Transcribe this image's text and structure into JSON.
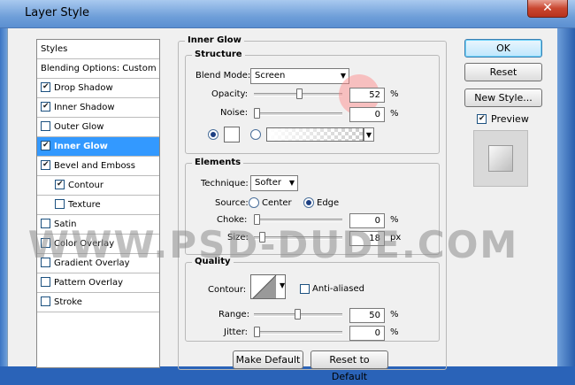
{
  "window": {
    "title": "Layer Style",
    "close_glyph": "✕"
  },
  "styles_panel": {
    "items": [
      {
        "label": "Styles",
        "checked": null,
        "indent": false,
        "selected": false
      },
      {
        "label": "Blending Options: Custom",
        "checked": null,
        "indent": false,
        "selected": false
      },
      {
        "label": "Drop Shadow",
        "checked": true,
        "indent": false,
        "selected": false
      },
      {
        "label": "Inner Shadow",
        "checked": true,
        "indent": false,
        "selected": false
      },
      {
        "label": "Outer Glow",
        "checked": false,
        "indent": false,
        "selected": false
      },
      {
        "label": "Inner Glow",
        "checked": true,
        "indent": false,
        "selected": true
      },
      {
        "label": "Bevel and Emboss",
        "checked": true,
        "indent": false,
        "selected": false
      },
      {
        "label": "Contour",
        "checked": true,
        "indent": true,
        "selected": false
      },
      {
        "label": "Texture",
        "checked": false,
        "indent": true,
        "selected": false
      },
      {
        "label": "Satin",
        "checked": false,
        "indent": false,
        "selected": false
      },
      {
        "label": "Color Overlay",
        "checked": false,
        "indent": false,
        "selected": false
      },
      {
        "label": "Gradient Overlay",
        "checked": false,
        "indent": false,
        "selected": false
      },
      {
        "label": "Pattern Overlay",
        "checked": false,
        "indent": false,
        "selected": false
      },
      {
        "label": "Stroke",
        "checked": false,
        "indent": false,
        "selected": false
      }
    ]
  },
  "inner_glow": {
    "section_title": "Inner Glow",
    "structure": {
      "title": "Structure",
      "blend_mode_label": "Blend Mode:",
      "blend_mode_value": "Screen",
      "opacity_label": "Opacity:",
      "opacity_value": "52",
      "opacity_fraction": 0.52,
      "noise_label": "Noise:",
      "noise_value": "0",
      "noise_fraction": 0.0,
      "unit": "%"
    },
    "elements": {
      "title": "Elements",
      "technique_label": "Technique:",
      "technique_value": "Softer",
      "source_label": "Source:",
      "source_center": "Center",
      "source_edge": "Edge",
      "choke_label": "Choke:",
      "choke_value": "0",
      "choke_fraction": 0.0,
      "choke_unit": "%",
      "size_label": "Size:",
      "size_value": "18",
      "size_fraction": 0.07,
      "size_unit": "px"
    },
    "quality": {
      "title": "Quality",
      "contour_label": "Contour:",
      "anti_aliased_label": "Anti-aliased",
      "range_label": "Range:",
      "range_value": "50",
      "range_fraction": 0.5,
      "range_unit": "%",
      "jitter_label": "Jitter:",
      "jitter_value": "0",
      "jitter_fraction": 0.0,
      "jitter_unit": "%"
    },
    "make_default": "Make Default",
    "reset_default": "Reset to Default"
  },
  "buttons": {
    "ok": "OK",
    "reset": "Reset",
    "new_style": "New Style...",
    "preview_label": "Preview"
  },
  "watermark": "WWW.PSD-DUDE.COM"
}
